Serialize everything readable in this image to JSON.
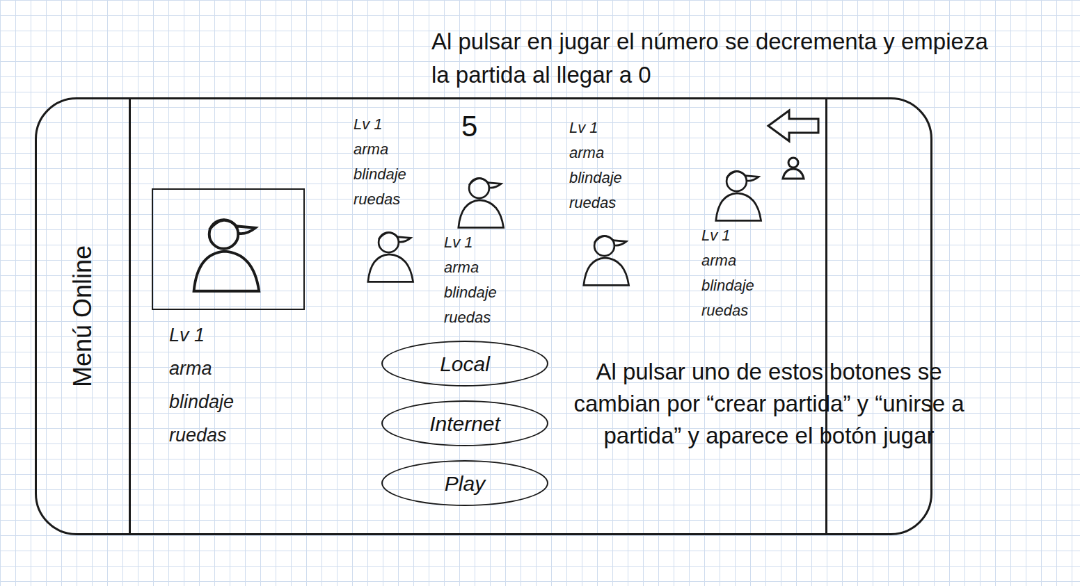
{
  "annotations": {
    "top": "Al pulsar en jugar el número se decrementa y empieza la partida al llegar a 0",
    "bottom": "Al pulsar uno de estos botones se cambian por “crear partida” y “unirse a partida” y aparece el botón jugar"
  },
  "sidebar": {
    "title": "Menú Online"
  },
  "countdown": "5",
  "players": [
    {
      "kind": "stats-below",
      "selected": true,
      "stats": [
        "Lv 1",
        "arma",
        "blindaje",
        "ruedas"
      ]
    },
    {
      "kind": "stats-above",
      "selected": false,
      "stats": [
        "Lv 1",
        "arma",
        "blindaje",
        "ruedas"
      ]
    },
    {
      "kind": "stats-below",
      "selected": false,
      "stats": [
        "Lv 1",
        "arma",
        "blindaje",
        "ruedas"
      ]
    },
    {
      "kind": "stats-above",
      "selected": false,
      "stats": [
        "Lv 1",
        "arma",
        "blindaje",
        "ruedas"
      ]
    },
    {
      "kind": "stats-below",
      "selected": false,
      "stats": [
        "Lv 1",
        "arma",
        "blindaje",
        "ruedas"
      ]
    }
  ],
  "buttons": [
    {
      "label": "Local"
    },
    {
      "label": "Internet"
    },
    {
      "label": "Play"
    }
  ]
}
